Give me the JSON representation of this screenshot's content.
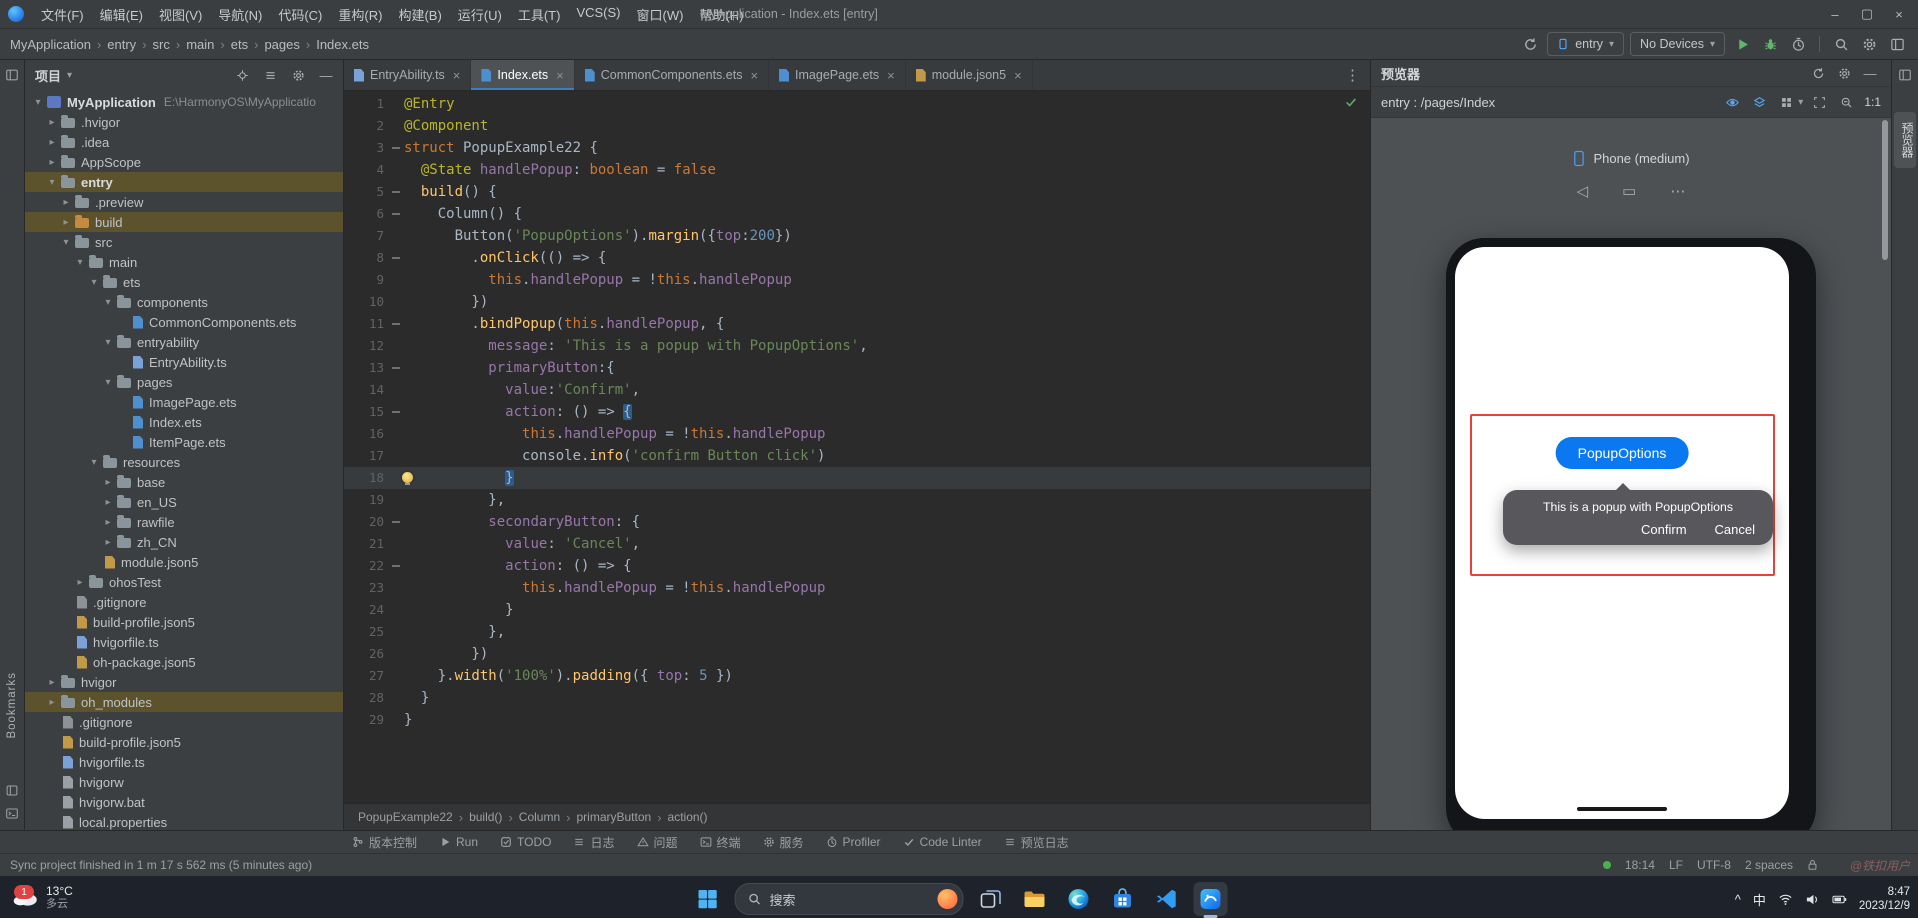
{
  "colors": {
    "accent": "#3d7ebd",
    "run_green": "#5fb865",
    "popup_button_blue": "#0a78f0",
    "inspect_red": "#e8413c",
    "tree_highlight": "#5c532c"
  },
  "titlebar": {
    "title": "MyApplication - Index.ets [entry]",
    "menus": [
      "文件(F)",
      "编辑(E)",
      "视图(V)",
      "导航(N)",
      "代码(C)",
      "重构(R)",
      "构建(B)",
      "运行(U)",
      "工具(T)",
      "VCS(S)",
      "窗口(W)",
      "帮助(H)"
    ]
  },
  "toolbar": {
    "breadcrumbs": [
      "MyApplication",
      "entry",
      "src",
      "main",
      "ets",
      "pages",
      "Index.ets"
    ],
    "module": "entry",
    "devices": "No Devices"
  },
  "stripes": {
    "right_tab": "预览器",
    "bookmarks": "Bookmarks"
  },
  "project": {
    "header": "项目",
    "tree": [
      {
        "i": 0,
        "a": "d",
        "ic": "project",
        "l": "MyApplication",
        "x": "E:\\HarmonyOS\\MyApplicatio",
        "b": 1
      },
      {
        "i": 1,
        "a": "r",
        "ic": "folder",
        "l": ".hvigor"
      },
      {
        "i": 1,
        "a": "r",
        "ic": "folder",
        "l": ".idea"
      },
      {
        "i": 1,
        "a": "r",
        "ic": "folder",
        "l": "AppScope"
      },
      {
        "i": 1,
        "a": "d",
        "ic": "folder",
        "l": "entry",
        "hl": 1,
        "b": 1
      },
      {
        "i": 2,
        "a": "r",
        "ic": "folder",
        "l": ".preview"
      },
      {
        "i": 2,
        "a": "r",
        "ic": "folderB",
        "l": "build",
        "hl": 1
      },
      {
        "i": 2,
        "a": "d",
        "ic": "folder",
        "l": "src"
      },
      {
        "i": 3,
        "a": "d",
        "ic": "folder",
        "l": "main"
      },
      {
        "i": 4,
        "a": "d",
        "ic": "folder",
        "l": "ets"
      },
      {
        "i": 5,
        "a": "d",
        "ic": "folder",
        "l": "components"
      },
      {
        "i": 6,
        "ic": "fileE",
        "l": "CommonComponents.ets"
      },
      {
        "i": 5,
        "a": "d",
        "ic": "folder",
        "l": "entryability"
      },
      {
        "i": 6,
        "ic": "fileT",
        "l": "EntryAbility.ts"
      },
      {
        "i": 5,
        "a": "d",
        "ic": "folder",
        "l": "pages"
      },
      {
        "i": 6,
        "ic": "fileE",
        "l": "ImagePage.ets"
      },
      {
        "i": 6,
        "ic": "fileE",
        "l": "Index.ets"
      },
      {
        "i": 6,
        "ic": "fileE",
        "l": "ItemPage.ets"
      },
      {
        "i": 4,
        "a": "d",
        "ic": "folder",
        "l": "resources"
      },
      {
        "i": 5,
        "a": "r",
        "ic": "folder",
        "l": "base"
      },
      {
        "i": 5,
        "a": "r",
        "ic": "folder",
        "l": "en_US"
      },
      {
        "i": 5,
        "a": "r",
        "ic": "folder",
        "l": "rawfile"
      },
      {
        "i": 5,
        "a": "r",
        "ic": "folder",
        "l": "zh_CN"
      },
      {
        "i": 4,
        "ic": "fileJ",
        "l": "module.json5"
      },
      {
        "i": 3,
        "a": "r",
        "ic": "folder",
        "l": "ohosTest"
      },
      {
        "i": 2,
        "ic": "fileG",
        "l": ".gitignore"
      },
      {
        "i": 2,
        "ic": "fileJ",
        "l": "build-profile.json5"
      },
      {
        "i": 2,
        "ic": "fileT",
        "l": "hvigorfile.ts"
      },
      {
        "i": 2,
        "ic": "fileJ",
        "l": "oh-package.json5"
      },
      {
        "i": 1,
        "a": "r",
        "ic": "folder",
        "l": "hvigor"
      },
      {
        "i": 1,
        "a": "r",
        "ic": "folder",
        "l": "oh_modules",
        "hl": 1
      },
      {
        "i": 1,
        "ic": "fileG",
        "l": ".gitignore"
      },
      {
        "i": 1,
        "ic": "fileJ",
        "l": "build-profile.json5"
      },
      {
        "i": 1,
        "ic": "fileT",
        "l": "hvigorfile.ts"
      },
      {
        "i": 1,
        "ic": "fileP",
        "l": "hvigorw"
      },
      {
        "i": 1,
        "ic": "fileP",
        "l": "hvigorw.bat"
      },
      {
        "i": 1,
        "ic": "fileP",
        "l": "local.properties"
      }
    ]
  },
  "editor": {
    "tabs": [
      {
        "label": "EntryAbility.ts",
        "icon": "fileT",
        "active": false
      },
      {
        "label": "Index.ets",
        "icon": "fileE",
        "active": true
      },
      {
        "label": "CommonComponents.ets",
        "icon": "fileE",
        "active": false
      },
      {
        "label": "ImagePage.ets",
        "icon": "fileE",
        "active": false
      },
      {
        "label": "module.json5",
        "icon": "fileJ",
        "active": false
      }
    ],
    "breadcrumbs": [
      "PopupExample22",
      "build()",
      "Column",
      "primaryButton",
      "action()"
    ],
    "lines": [
      {
        "n": 1,
        "segs": [
          [
            "dec",
            "@Entry"
          ]
        ]
      },
      {
        "n": 2,
        "segs": [
          [
            "dec",
            "@Component"
          ]
        ]
      },
      {
        "n": 3,
        "f": 1,
        "segs": [
          [
            "kw",
            "struct"
          ],
          [
            "d",
            " PopupExample22 {"
          ]
        ]
      },
      {
        "n": 4,
        "segs": [
          [
            "d",
            "  "
          ],
          [
            "dec",
            "@State"
          ],
          [
            "d",
            " "
          ],
          [
            "pr",
            "handlePopup"
          ],
          [
            "d",
            ": "
          ],
          [
            "kw",
            "boolean"
          ],
          [
            "d",
            " = "
          ],
          [
            "kw",
            "false"
          ]
        ]
      },
      {
        "n": 5,
        "f": 1,
        "segs": [
          [
            "d",
            "  "
          ],
          [
            "fn",
            "build"
          ],
          [
            "d",
            "() {"
          ]
        ]
      },
      {
        "n": 6,
        "f": 1,
        "segs": [
          [
            "d",
            "    Column() {"
          ]
        ]
      },
      {
        "n": 7,
        "segs": [
          [
            "d",
            "      Button("
          ],
          [
            "str",
            "'PopupOptions'"
          ],
          [
            "d",
            ")."
          ],
          [
            "fn",
            "margin"
          ],
          [
            "d",
            "({"
          ],
          [
            "pr",
            "top"
          ],
          [
            "d",
            ":"
          ],
          [
            "num",
            "200"
          ],
          [
            "d",
            "})"
          ]
        ]
      },
      {
        "n": 8,
        "f": 1,
        "segs": [
          [
            "d",
            "        ."
          ],
          [
            "fn",
            "onClick"
          ],
          [
            "d",
            "(() => {"
          ]
        ]
      },
      {
        "n": 9,
        "segs": [
          [
            "d",
            "          "
          ],
          [
            "kw",
            "this"
          ],
          [
            "d",
            "."
          ],
          [
            "pr",
            "handlePopup"
          ],
          [
            "d",
            " = !"
          ],
          [
            "kw",
            "this"
          ],
          [
            "d",
            "."
          ],
          [
            "pr",
            "handlePopup"
          ]
        ]
      },
      {
        "n": 10,
        "segs": [
          [
            "d",
            "        })"
          ]
        ]
      },
      {
        "n": 11,
        "f": 1,
        "segs": [
          [
            "d",
            "        ."
          ],
          [
            "fn",
            "bindPopup"
          ],
          [
            "d",
            "("
          ],
          [
            "kw",
            "this"
          ],
          [
            "d",
            "."
          ],
          [
            "pr",
            "handlePopup"
          ],
          [
            "d",
            ", {"
          ]
        ]
      },
      {
        "n": 12,
        "segs": [
          [
            "d",
            "          "
          ],
          [
            "pr",
            "message"
          ],
          [
            "d",
            ": "
          ],
          [
            "str",
            "'This is a popup with PopupOptions'"
          ],
          [
            "d",
            ","
          ]
        ]
      },
      {
        "n": 13,
        "f": 1,
        "segs": [
          [
            "d",
            "          "
          ],
          [
            "pr",
            "primaryButton"
          ],
          [
            "d",
            ":{"
          ]
        ]
      },
      {
        "n": 14,
        "segs": [
          [
            "d",
            "            "
          ],
          [
            "pr",
            "value"
          ],
          [
            "d",
            ":"
          ],
          [
            "str",
            "'Confirm'"
          ],
          [
            "d",
            ","
          ]
        ]
      },
      {
        "n": 15,
        "f": 1,
        "segs": [
          [
            "d",
            "            "
          ],
          [
            "pr",
            "action"
          ],
          [
            "d",
            ": () => "
          ],
          [
            "bm",
            "{"
          ]
        ]
      },
      {
        "n": 16,
        "segs": [
          [
            "d",
            "              "
          ],
          [
            "kw",
            "this"
          ],
          [
            "d",
            "."
          ],
          [
            "pr",
            "handlePopup"
          ],
          [
            "d",
            " = !"
          ],
          [
            "kw",
            "this"
          ],
          [
            "d",
            "."
          ],
          [
            "pr",
            "handlePopup"
          ]
        ]
      },
      {
        "n": 17,
        "segs": [
          [
            "d",
            "              console."
          ],
          [
            "fn",
            "info"
          ],
          [
            "d",
            "("
          ],
          [
            "str",
            "'confirm Button click'"
          ],
          [
            "d",
            ")"
          ]
        ]
      },
      {
        "n": 18,
        "cur": 1,
        "bulb": 1,
        "segs": [
          [
            "d",
            "            "
          ],
          [
            "bm",
            "}"
          ]
        ]
      },
      {
        "n": 19,
        "segs": [
          [
            "d",
            "          },"
          ]
        ]
      },
      {
        "n": 20,
        "f": 1,
        "segs": [
          [
            "d",
            "          "
          ],
          [
            "pr",
            "secondaryButton"
          ],
          [
            "d",
            ": {"
          ]
        ]
      },
      {
        "n": 21,
        "segs": [
          [
            "d",
            "            "
          ],
          [
            "pr",
            "value"
          ],
          [
            "d",
            ": "
          ],
          [
            "str",
            "'Cancel'"
          ],
          [
            "d",
            ","
          ]
        ]
      },
      {
        "n": 22,
        "f": 1,
        "segs": [
          [
            "d",
            "            "
          ],
          [
            "pr",
            "action"
          ],
          [
            "d",
            ": () => {"
          ]
        ]
      },
      {
        "n": 23,
        "segs": [
          [
            "d",
            "              "
          ],
          [
            "kw",
            "this"
          ],
          [
            "d",
            "."
          ],
          [
            "pr",
            "handlePopup"
          ],
          [
            "d",
            " = !"
          ],
          [
            "kw",
            "this"
          ],
          [
            "d",
            "."
          ],
          [
            "pr",
            "handlePopup"
          ]
        ]
      },
      {
        "n": 24,
        "segs": [
          [
            "d",
            "            }"
          ]
        ]
      },
      {
        "n": 25,
        "segs": [
          [
            "d",
            "          },"
          ]
        ]
      },
      {
        "n": 26,
        "segs": [
          [
            "d",
            "        })"
          ]
        ]
      },
      {
        "n": 27,
        "segs": [
          [
            "d",
            "    }."
          ],
          [
            "fn",
            "width"
          ],
          [
            "d",
            "("
          ],
          [
            "str",
            "'100%'"
          ],
          [
            "d",
            ")."
          ],
          [
            "fn",
            "padding"
          ],
          [
            "d",
            "({ "
          ],
          [
            "pr",
            "top"
          ],
          [
            "d",
            ": "
          ],
          [
            "num",
            "5"
          ],
          [
            "d",
            " })"
          ]
        ]
      },
      {
        "n": 28,
        "segs": [
          [
            "d",
            "  }"
          ]
        ]
      },
      {
        "n": 29,
        "segs": [
          [
            "d",
            "}"
          ]
        ]
      }
    ]
  },
  "previewer": {
    "title": "预览器",
    "route": "entry : /pages/Index",
    "device": "Phone (medium)",
    "zoom": "1:1",
    "button_label": "PopupOptions",
    "popup": {
      "message": "This is a popup with PopupOptions",
      "confirm": "Confirm",
      "cancel": "Cancel"
    }
  },
  "toolwindows": [
    {
      "id": "version-control",
      "icon": "branch",
      "label": "版本控制"
    },
    {
      "id": "run",
      "icon": "run",
      "label": "Run"
    },
    {
      "id": "todo",
      "icon": "todo",
      "label": "TODO"
    },
    {
      "id": "hilog",
      "icon": "log",
      "label": "日志"
    },
    {
      "id": "problems",
      "icon": "warn",
      "label": "问题"
    },
    {
      "id": "terminal",
      "icon": "terminal",
      "label": "终端"
    },
    {
      "id": "services",
      "icon": "services",
      "label": "服务"
    },
    {
      "id": "profiler",
      "icon": "profiler",
      "label": "Profiler"
    },
    {
      "id": "code-linter",
      "icon": "check",
      "label": "Code Linter"
    },
    {
      "id": "preview-log",
      "icon": "log",
      "label": "预览日志"
    }
  ],
  "statusbar": {
    "sync": "Sync project finished in 1 m 17 s 562 ms (5 minutes ago)",
    "task_time": "18:14",
    "eol": "LF",
    "encoding": "UTF-8",
    "indent": "2 spaces"
  },
  "taskbar": {
    "weather_temp": "13°C",
    "weather_desc": "多云",
    "badge": "1",
    "search": "搜索",
    "ime": "中",
    "clock": "8:47",
    "date": "2023/12/9"
  },
  "watermark": {
    "text": "@铁扣用户"
  }
}
